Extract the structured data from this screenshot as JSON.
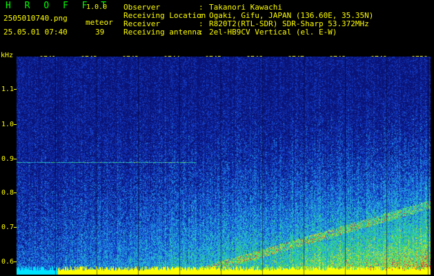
{
  "header": {
    "brand": "H R O F F T",
    "version": "1.0.0",
    "filename": "2505010740.png",
    "mode": "meteor",
    "datetime": "25.05.01 07:40",
    "count": "39"
  },
  "info": [
    {
      "label": "Observer",
      "value": "Takanori Kawachi"
    },
    {
      "label": "Receiving Location",
      "value": "Ogaki, Gifu, JAPAN (136.60E, 35.35N)"
    },
    {
      "label": "Receiver",
      "value": "R820T2(RTL-SDR) SDR-Sharp 53.372MHz"
    },
    {
      "label": "Receiving antenna",
      "value": "2el-HB9CV Vertical (el. E-W)"
    }
  ],
  "axis": {
    "unit": "kHz",
    "y_ticks": [
      "1.1",
      "1.0",
      "0.9",
      "0.8",
      "0.7",
      "0.6"
    ],
    "x_ticks": [
      "0741",
      "0742",
      "0743",
      "0744",
      "0745",
      "0746",
      "0747",
      "0748",
      "0749",
      "0750"
    ]
  },
  "colors": {
    "text": "#ffff00",
    "brand": "#00ff00",
    "background": "#000000"
  }
}
